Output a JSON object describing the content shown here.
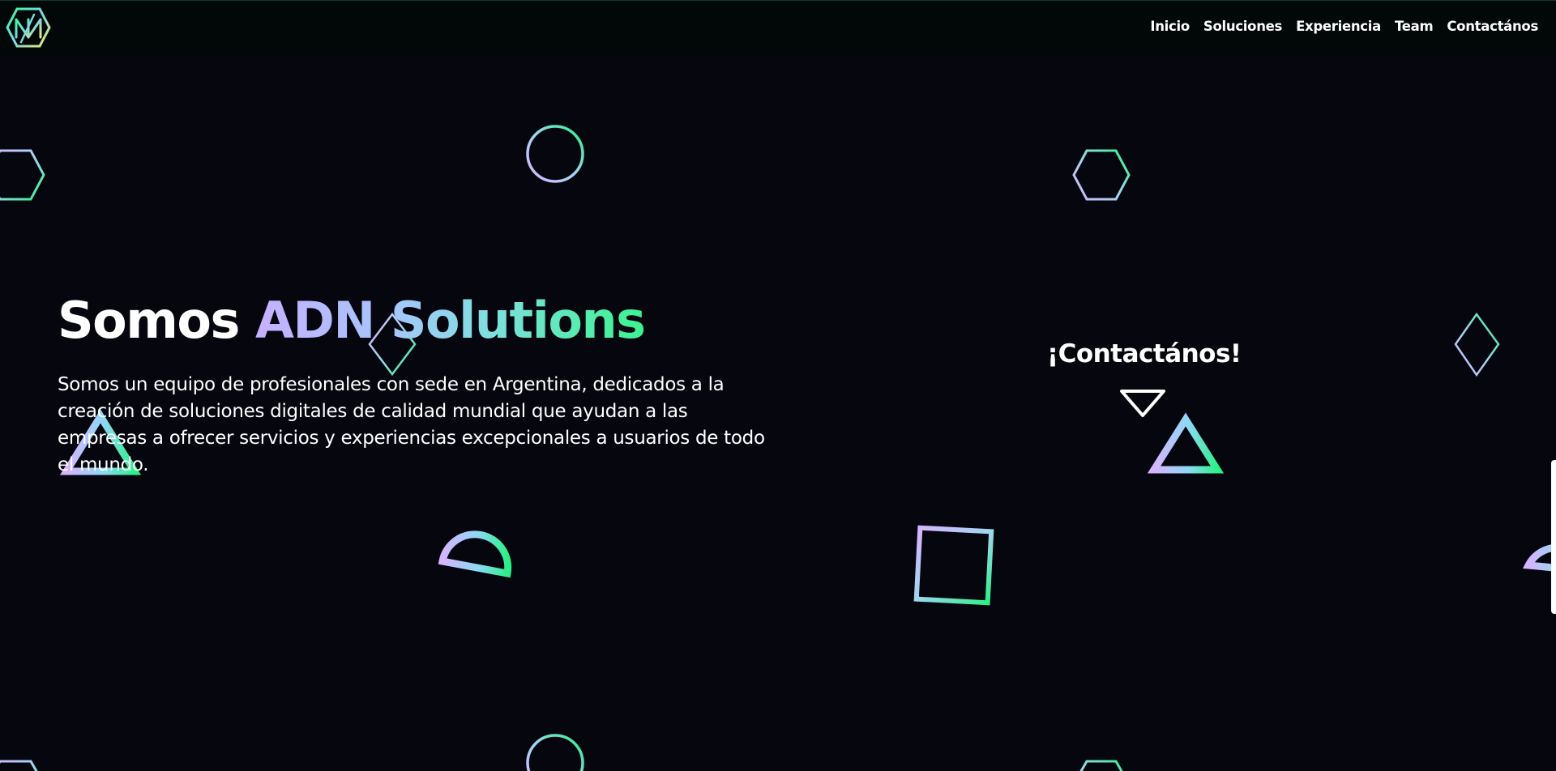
{
  "nav": {
    "logo_icon": "adn-logo-icon",
    "links": [
      "Inicio",
      "Soluciones",
      "Experiencia",
      "Team",
      "Contactános"
    ]
  },
  "hero": {
    "title_plain": "Somos ",
    "title_highlight": "ADN Solutions",
    "description": "Somos un equipo de profesionales con sede en Argentina, dedicados a la creación de soluciones digitales de calidad mundial que ayudan a las empresas a ofrecer servicios y experiencias excepcionales a usuarios de todo el mundo."
  },
  "cta": {
    "title": "¡Contactános!",
    "arrow_icon": "down-triangle-icon"
  },
  "colors": {
    "background": "#06060f",
    "navbar": "#020807",
    "gradient_start": "#c6b0ff",
    "gradient_end": "#3cf38e",
    "text": "#ffffff"
  }
}
